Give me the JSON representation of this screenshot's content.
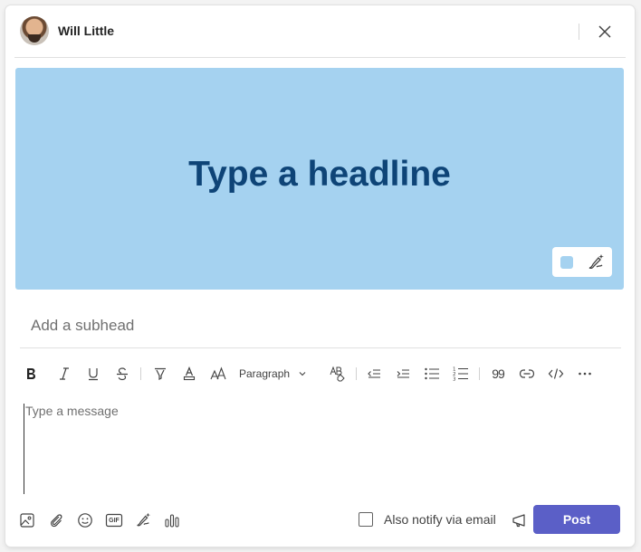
{
  "author": {
    "name": "Will Little"
  },
  "banner": {
    "headline": "Type a headline",
    "color": "#a5d2f0",
    "headline_color": "#0e4477"
  },
  "subhead": {
    "placeholder": "Add a subhead"
  },
  "toolbar": {
    "paragraph_label": "Paragraph",
    "quote_label": "99",
    "items": [
      "bold-icon",
      "italic-icon",
      "underline-icon",
      "strikethrough-icon",
      "highlight-icon",
      "font-color-icon",
      "font-size-icon",
      "paragraph-dropdown",
      "clear-formatting-icon",
      "decrease-indent-icon",
      "increase-indent-icon",
      "bulleted-list-icon",
      "numbered-list-icon",
      "quote-icon",
      "link-icon",
      "code-snippet-icon",
      "more-options-icon"
    ]
  },
  "message": {
    "placeholder": "Type a message"
  },
  "bottom": {
    "gif_label": "GIF",
    "notify_label": "Also notify via email",
    "notify_checked": false,
    "post_label": "Post",
    "post_color": "#5b5fc7"
  }
}
